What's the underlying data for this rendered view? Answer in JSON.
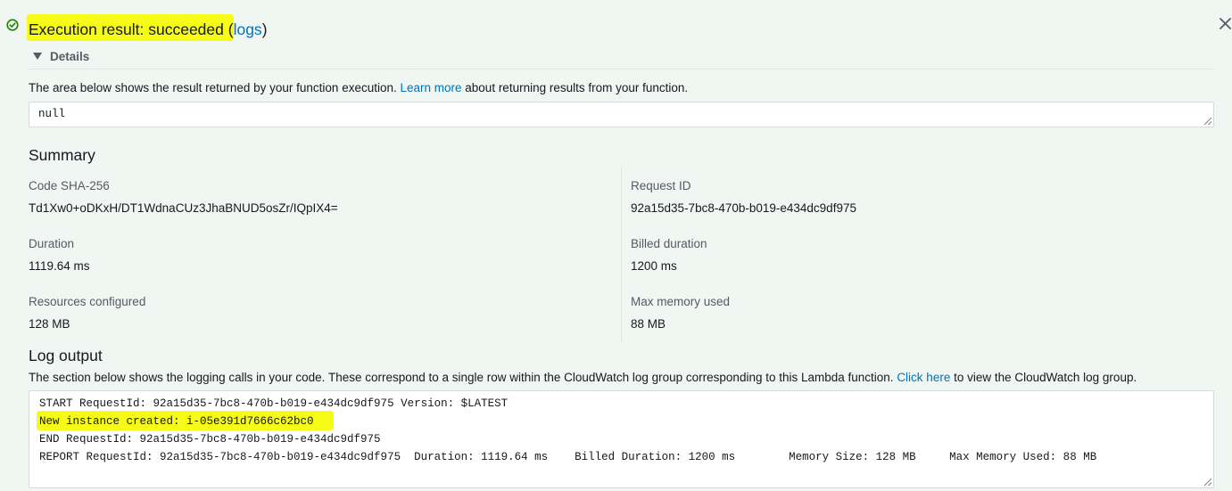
{
  "header": {
    "status_icon": "check-circle-icon",
    "status_color": "#1d8102",
    "title_prefix": "Execution result: succeeded (",
    "logs_link": "logs",
    "title_suffix": ")",
    "close_icon": "close-icon"
  },
  "details": {
    "toggle_label": "Details",
    "result_intro_before": "The area below shows the result returned by your function execution. ",
    "result_intro_link": "Learn more",
    "result_intro_after": " about returning results from your function.",
    "result_value": "null"
  },
  "summary": {
    "heading": "Summary",
    "fields": [
      {
        "label": "Code SHA-256",
        "value": "Td1Xw0+oDKxH/DT1WdnaCUz3JhaBNUD5osZr/IQpIX4="
      },
      {
        "label": "Request ID",
        "value": "92a15d35-7bc8-470b-b019-e434dc9df975"
      },
      {
        "label": "Duration",
        "value": "1119.64 ms"
      },
      {
        "label": "Billed duration",
        "value": "1200 ms"
      },
      {
        "label": "Resources configured",
        "value": "128 MB"
      },
      {
        "label": "Max memory used",
        "value": "88 MB"
      }
    ]
  },
  "log_output": {
    "heading": "Log output",
    "intro_before": "The section below shows the logging calls in your code. These correspond to a single row within the CloudWatch log group corresponding to this Lambda function. ",
    "intro_link": "Click here",
    "intro_after": " to view the CloudWatch log group.",
    "lines": [
      "START RequestId: 92a15d35-7bc8-470b-b019-e434dc9df975 Version: $LATEST",
      "New instance created: i-05e391d7666c62bc0",
      "END RequestId: 92a15d35-7bc8-470b-b019-e434dc9df975",
      "REPORT RequestId: 92a15d35-7bc8-470b-b019-e434dc9df975  Duration: 1119.64 ms    Billed Duration: 1200 ms        Memory Size: 128 MB     Max Memory Used: 88 MB"
    ]
  },
  "colors": {
    "background": "#f0f6f1",
    "link": "#0073bb",
    "highlight": "#f6fb18"
  }
}
